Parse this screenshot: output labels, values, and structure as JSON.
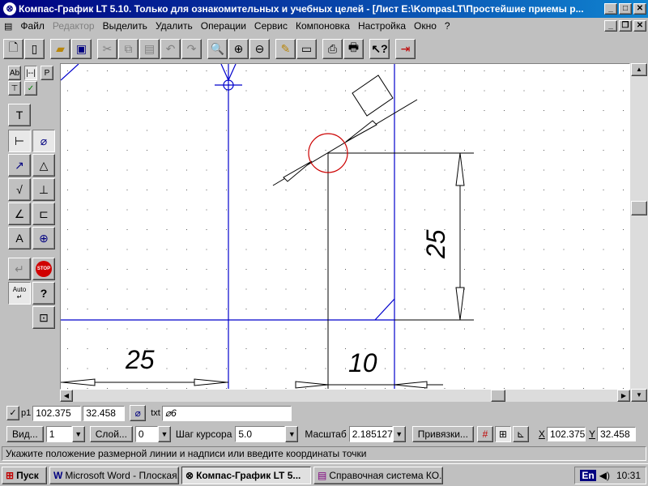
{
  "window": {
    "title": "Компас-График LT 5.10. Только для ознакомительных и учебных целей - [Лист E:\\KompasLT\\Простейшие приемы р..."
  },
  "menu": [
    {
      "label": "Файл",
      "disabled": false
    },
    {
      "label": "Редактор",
      "disabled": true
    },
    {
      "label": "Выделить",
      "disabled": false
    },
    {
      "label": "Удалить",
      "disabled": false
    },
    {
      "label": "Операции",
      "disabled": false
    },
    {
      "label": "Сервис",
      "disabled": false
    },
    {
      "label": "Компоновка",
      "disabled": false
    },
    {
      "label": "Настройка",
      "disabled": false
    },
    {
      "label": "Окно",
      "disabled": false
    },
    {
      "label": "?",
      "disabled": false
    }
  ],
  "toolbar_icons": [
    "new-sheet-icon",
    "new-document-icon",
    "open-icon",
    "save-icon",
    "cut-icon",
    "copy-icon",
    "paste-icon",
    "undo-icon",
    "redo-icon",
    "zoom-icon",
    "zoom-in-icon",
    "zoom-out-icon",
    "pan-icon",
    "show-all-icon",
    "preview-icon",
    "print-icon",
    "help-pointer-icon",
    "exit-icon"
  ],
  "left_tool_tabs": [
    "Ab",
    "|--|",
    "P"
  ],
  "left_tool_labels": {
    "stop": "STOP",
    "auto": "Auto",
    "help": "?"
  },
  "drawing": {
    "dimension_left": "25",
    "dimension_bottom": "10",
    "dimension_vertical": "25",
    "line_color": "#0000cc",
    "circle_color": "#cc0000"
  },
  "propbar": {
    "p1_label": "p1",
    "x_value": "102.375",
    "y_value": "32.458",
    "txt_label": "txt",
    "txt_value": "⌀6"
  },
  "statusbar": {
    "view_btn": "Вид...",
    "view_value": "1",
    "layer_btn": "Слой...",
    "layer_value": "0",
    "step_label": "Шаг курсора",
    "step_value": "5.0",
    "scale_label": "Масштаб",
    "scale_value": "2.185127",
    "snaps_btn": "Привязки...",
    "x_label": "X",
    "x_value": "102.375",
    "y_label": "Y",
    "y_value": "32.458",
    "hint": "Укажите положение размерной линии и надписи или введите координаты точки"
  },
  "taskbar": {
    "start": "Пуск",
    "tasks": [
      {
        "label": "Microsoft Word - Плоская...",
        "active": false
      },
      {
        "label": "Компас-График LT 5...",
        "active": true
      },
      {
        "label": "Справочная система КО...",
        "active": false
      }
    ],
    "lang": "En",
    "clock": "10:31"
  }
}
